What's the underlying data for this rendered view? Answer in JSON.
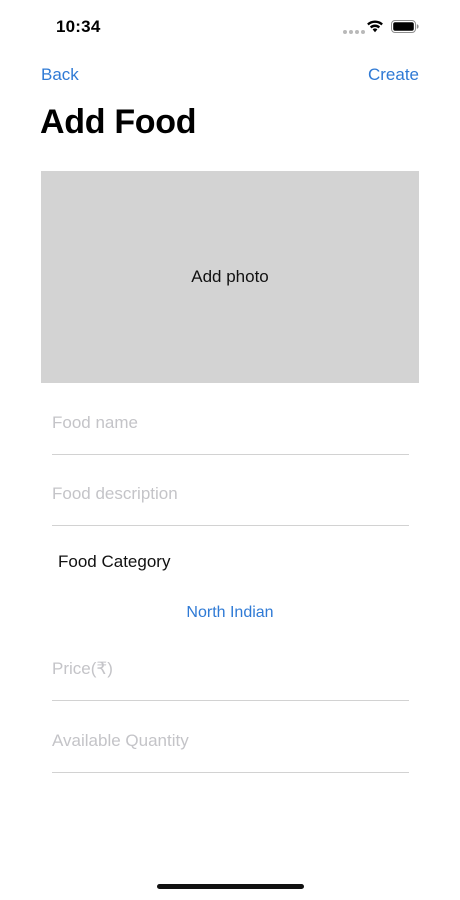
{
  "status_bar": {
    "time": "10:34"
  },
  "nav": {
    "back_label": "Back",
    "create_label": "Create"
  },
  "page": {
    "title": "Add Food"
  },
  "photo": {
    "label": "Add photo"
  },
  "form": {
    "food_name": {
      "placeholder": "Food name",
      "value": ""
    },
    "food_description": {
      "placeholder": "Food description",
      "value": ""
    },
    "category_label": "Food Category",
    "category_selected": "North Indian",
    "price": {
      "placeholder": "Price(₹)",
      "value": ""
    },
    "available_quantity": {
      "placeholder": "Available Quantity",
      "value": ""
    }
  },
  "colors": {
    "accent": "#2f7ad5",
    "photo_background": "#d3d3d3",
    "placeholder": "#c4c4c8",
    "divider": "#d2d2d2"
  },
  "icons": {
    "signal": "signal-dots-icon",
    "wifi": "wifi-icon",
    "battery": "battery-icon"
  }
}
